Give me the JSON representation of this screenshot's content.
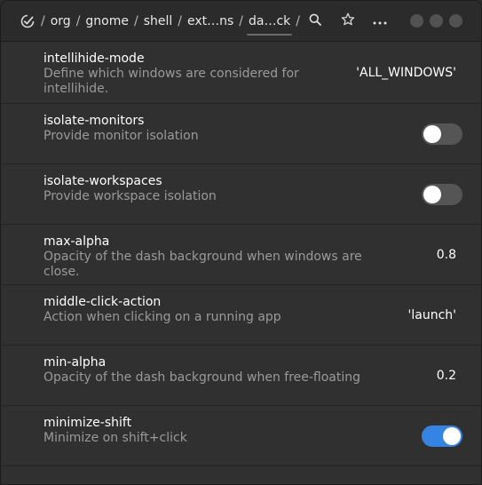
{
  "header": {
    "breadcrumbs": [
      "org",
      "gnome",
      "shell",
      "ext…ns",
      "da…ck"
    ],
    "separator": "/"
  },
  "rows": [
    {
      "key": "intellihide-mode",
      "desc": "Define which windows are considered for intellihide.",
      "kind": "text",
      "value": "'ALL_WINDOWS'"
    },
    {
      "key": "isolate-monitors",
      "desc": "Provide monitor isolation",
      "kind": "switch",
      "state": false
    },
    {
      "key": "isolate-workspaces",
      "desc": "Provide workspace isolation",
      "kind": "switch",
      "state": false
    },
    {
      "key": "max-alpha",
      "desc": "Opacity of the dash background when windows are close.",
      "kind": "text",
      "value": "0.8"
    },
    {
      "key": "middle-click-action",
      "desc": "Action when clicking on a running app",
      "kind": "text",
      "value": "'launch'"
    },
    {
      "key": "min-alpha",
      "desc": "Opacity of the dash background when free-floating",
      "kind": "text",
      "value": "0.2"
    },
    {
      "key": "minimize-shift",
      "desc": "Minimize on shift+click",
      "kind": "switch",
      "state": true
    }
  ],
  "colors": {
    "accent": "#3584e4",
    "background": "#303030",
    "header": "#2b2b2b",
    "secondary_text": "#9a9a9a"
  }
}
